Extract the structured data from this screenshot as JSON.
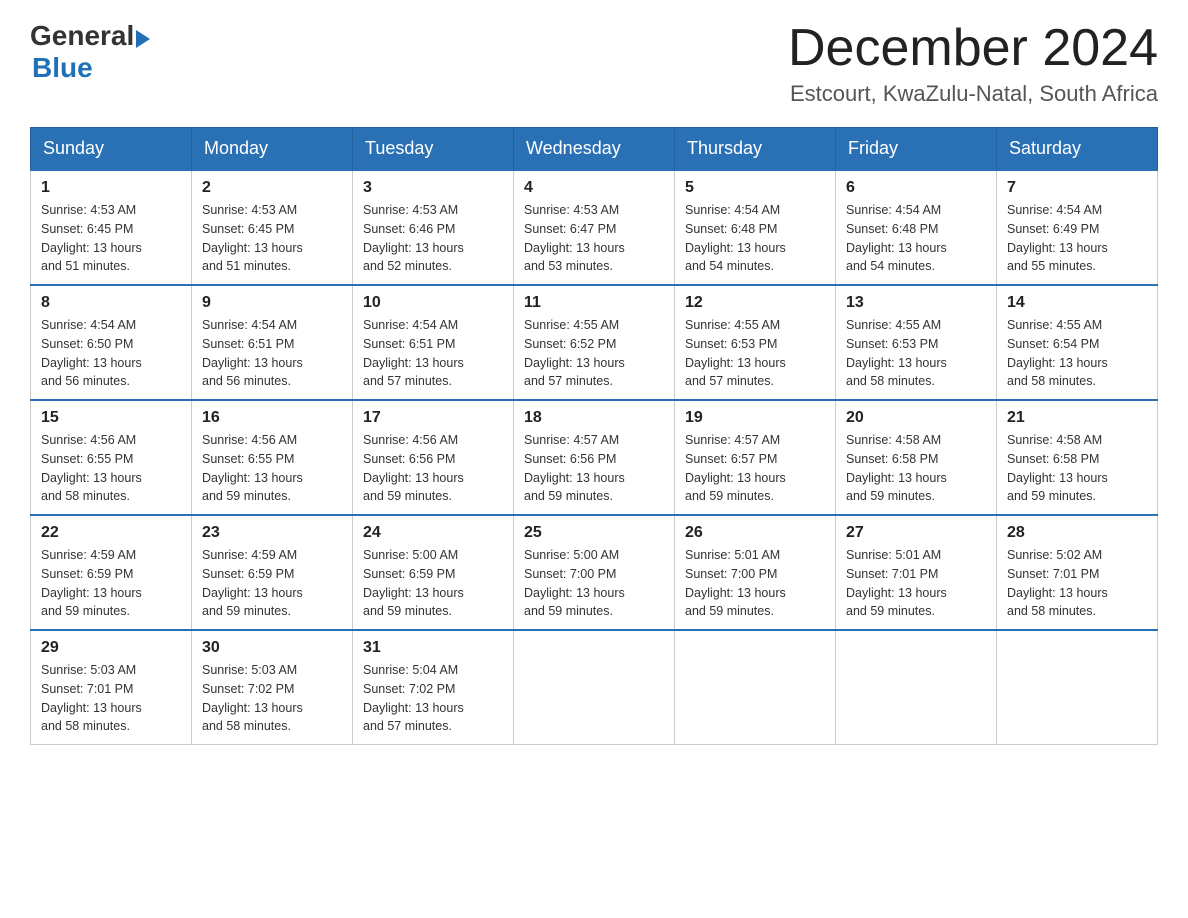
{
  "header": {
    "logo_general": "General",
    "logo_blue": "Blue",
    "month_year": "December 2024",
    "location": "Estcourt, KwaZulu-Natal, South Africa"
  },
  "days_of_week": [
    "Sunday",
    "Monday",
    "Tuesday",
    "Wednesday",
    "Thursday",
    "Friday",
    "Saturday"
  ],
  "weeks": [
    [
      {
        "day": "1",
        "sunrise": "4:53 AM",
        "sunset": "6:45 PM",
        "daylight": "13 hours and 51 minutes."
      },
      {
        "day": "2",
        "sunrise": "4:53 AM",
        "sunset": "6:45 PM",
        "daylight": "13 hours and 51 minutes."
      },
      {
        "day": "3",
        "sunrise": "4:53 AM",
        "sunset": "6:46 PM",
        "daylight": "13 hours and 52 minutes."
      },
      {
        "day": "4",
        "sunrise": "4:53 AM",
        "sunset": "6:47 PM",
        "daylight": "13 hours and 53 minutes."
      },
      {
        "day": "5",
        "sunrise": "4:54 AM",
        "sunset": "6:48 PM",
        "daylight": "13 hours and 54 minutes."
      },
      {
        "day": "6",
        "sunrise": "4:54 AM",
        "sunset": "6:48 PM",
        "daylight": "13 hours and 54 minutes."
      },
      {
        "day": "7",
        "sunrise": "4:54 AM",
        "sunset": "6:49 PM",
        "daylight": "13 hours and 55 minutes."
      }
    ],
    [
      {
        "day": "8",
        "sunrise": "4:54 AM",
        "sunset": "6:50 PM",
        "daylight": "13 hours and 56 minutes."
      },
      {
        "day": "9",
        "sunrise": "4:54 AM",
        "sunset": "6:51 PM",
        "daylight": "13 hours and 56 minutes."
      },
      {
        "day": "10",
        "sunrise": "4:54 AM",
        "sunset": "6:51 PM",
        "daylight": "13 hours and 57 minutes."
      },
      {
        "day": "11",
        "sunrise": "4:55 AM",
        "sunset": "6:52 PM",
        "daylight": "13 hours and 57 minutes."
      },
      {
        "day": "12",
        "sunrise": "4:55 AM",
        "sunset": "6:53 PM",
        "daylight": "13 hours and 57 minutes."
      },
      {
        "day": "13",
        "sunrise": "4:55 AM",
        "sunset": "6:53 PM",
        "daylight": "13 hours and 58 minutes."
      },
      {
        "day": "14",
        "sunrise": "4:55 AM",
        "sunset": "6:54 PM",
        "daylight": "13 hours and 58 minutes."
      }
    ],
    [
      {
        "day": "15",
        "sunrise": "4:56 AM",
        "sunset": "6:55 PM",
        "daylight": "13 hours and 58 minutes."
      },
      {
        "day": "16",
        "sunrise": "4:56 AM",
        "sunset": "6:55 PM",
        "daylight": "13 hours and 59 minutes."
      },
      {
        "day": "17",
        "sunrise": "4:56 AM",
        "sunset": "6:56 PM",
        "daylight": "13 hours and 59 minutes."
      },
      {
        "day": "18",
        "sunrise": "4:57 AM",
        "sunset": "6:56 PM",
        "daylight": "13 hours and 59 minutes."
      },
      {
        "day": "19",
        "sunrise": "4:57 AM",
        "sunset": "6:57 PM",
        "daylight": "13 hours and 59 minutes."
      },
      {
        "day": "20",
        "sunrise": "4:58 AM",
        "sunset": "6:58 PM",
        "daylight": "13 hours and 59 minutes."
      },
      {
        "day": "21",
        "sunrise": "4:58 AM",
        "sunset": "6:58 PM",
        "daylight": "13 hours and 59 minutes."
      }
    ],
    [
      {
        "day": "22",
        "sunrise": "4:59 AM",
        "sunset": "6:59 PM",
        "daylight": "13 hours and 59 minutes."
      },
      {
        "day": "23",
        "sunrise": "4:59 AM",
        "sunset": "6:59 PM",
        "daylight": "13 hours and 59 minutes."
      },
      {
        "day": "24",
        "sunrise": "5:00 AM",
        "sunset": "6:59 PM",
        "daylight": "13 hours and 59 minutes."
      },
      {
        "day": "25",
        "sunrise": "5:00 AM",
        "sunset": "7:00 PM",
        "daylight": "13 hours and 59 minutes."
      },
      {
        "day": "26",
        "sunrise": "5:01 AM",
        "sunset": "7:00 PM",
        "daylight": "13 hours and 59 minutes."
      },
      {
        "day": "27",
        "sunrise": "5:01 AM",
        "sunset": "7:01 PM",
        "daylight": "13 hours and 59 minutes."
      },
      {
        "day": "28",
        "sunrise": "5:02 AM",
        "sunset": "7:01 PM",
        "daylight": "13 hours and 58 minutes."
      }
    ],
    [
      {
        "day": "29",
        "sunrise": "5:03 AM",
        "sunset": "7:01 PM",
        "daylight": "13 hours and 58 minutes."
      },
      {
        "day": "30",
        "sunrise": "5:03 AM",
        "sunset": "7:02 PM",
        "daylight": "13 hours and 58 minutes."
      },
      {
        "day": "31",
        "sunrise": "5:04 AM",
        "sunset": "7:02 PM",
        "daylight": "13 hours and 57 minutes."
      },
      null,
      null,
      null,
      null
    ]
  ],
  "labels": {
    "sunrise": "Sunrise:",
    "sunset": "Sunset:",
    "daylight": "Daylight:"
  }
}
